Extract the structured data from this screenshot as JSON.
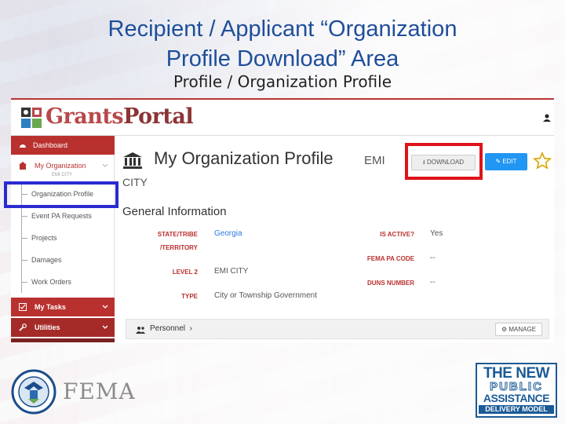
{
  "slide": {
    "title_line1": "Recipient / Applicant “Organization",
    "title_line2": "Profile Download” Area",
    "subtitle": "Profile / Organization Profile"
  },
  "app": {
    "logo_grants": "Grants",
    "logo_portal": "Portal"
  },
  "sidebar": {
    "dashboard": "Dashboard",
    "my_organization": "My Organization",
    "org_sub": "EMI CITY",
    "items": [
      {
        "label": "Organization Profile"
      },
      {
        "label": "Event PA Requests"
      },
      {
        "label": "Projects"
      },
      {
        "label": "Damages"
      },
      {
        "label": "Work Orders"
      }
    ],
    "my_tasks": "My Tasks",
    "utilities": "Utilities"
  },
  "main": {
    "title": "My Organization Profile",
    "title_suffix": "EMI",
    "title_city": "CITY",
    "download_label": "DOWNLOAD",
    "edit_label": "EDIT",
    "section_title": "General Information",
    "fields": {
      "state_label": "STATE/TRIBE",
      "territory_label": "/TERRITORY",
      "state_value": "Georgia",
      "level2_label": "LEVEL 2",
      "level2_value": "EMI CITY",
      "type_label": "TYPE",
      "type_value": "City or Township Government",
      "active_label": "IS ACTIVE?",
      "active_value": "Yes",
      "fema_code_label": "FEMA PA CODE",
      "fema_code_value": "--",
      "duns_label": "DUNS NUMBER",
      "duns_value": "--"
    },
    "personnel_label": "Personnel",
    "manage_label": "MANAGE"
  },
  "footer": {
    "fema": "FEMA",
    "badge_line1": "THE NEW",
    "badge_line2": "PUBLIC",
    "badge_line3": "ASSISTANCE",
    "badge_line4": "DELIVERY MODEL"
  },
  "colors": {
    "title_blue": "#1f4e9a",
    "sidebar_red": "#b9312f",
    "edit_blue": "#2196f3",
    "highlight_red": "#e0121a",
    "highlight_blue": "#2a2ad0"
  }
}
